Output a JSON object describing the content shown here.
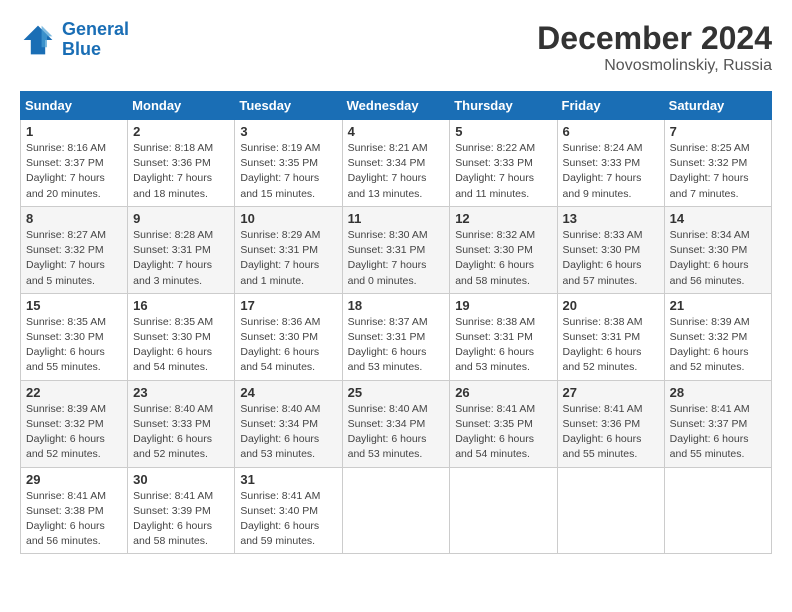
{
  "header": {
    "logo_line1": "General",
    "logo_line2": "Blue",
    "month_title": "December 2024",
    "location": "Novosmolinskiy, Russia"
  },
  "days_of_week": [
    "Sunday",
    "Monday",
    "Tuesday",
    "Wednesday",
    "Thursday",
    "Friday",
    "Saturday"
  ],
  "weeks": [
    [
      {
        "day": "1",
        "info": "Sunrise: 8:16 AM\nSunset: 3:37 PM\nDaylight: 7 hours\nand 20 minutes."
      },
      {
        "day": "2",
        "info": "Sunrise: 8:18 AM\nSunset: 3:36 PM\nDaylight: 7 hours\nand 18 minutes."
      },
      {
        "day": "3",
        "info": "Sunrise: 8:19 AM\nSunset: 3:35 PM\nDaylight: 7 hours\nand 15 minutes."
      },
      {
        "day": "4",
        "info": "Sunrise: 8:21 AM\nSunset: 3:34 PM\nDaylight: 7 hours\nand 13 minutes."
      },
      {
        "day": "5",
        "info": "Sunrise: 8:22 AM\nSunset: 3:33 PM\nDaylight: 7 hours\nand 11 minutes."
      },
      {
        "day": "6",
        "info": "Sunrise: 8:24 AM\nSunset: 3:33 PM\nDaylight: 7 hours\nand 9 minutes."
      },
      {
        "day": "7",
        "info": "Sunrise: 8:25 AM\nSunset: 3:32 PM\nDaylight: 7 hours\nand 7 minutes."
      }
    ],
    [
      {
        "day": "8",
        "info": "Sunrise: 8:27 AM\nSunset: 3:32 PM\nDaylight: 7 hours\nand 5 minutes."
      },
      {
        "day": "9",
        "info": "Sunrise: 8:28 AM\nSunset: 3:31 PM\nDaylight: 7 hours\nand 3 minutes."
      },
      {
        "day": "10",
        "info": "Sunrise: 8:29 AM\nSunset: 3:31 PM\nDaylight: 7 hours\nand 1 minute."
      },
      {
        "day": "11",
        "info": "Sunrise: 8:30 AM\nSunset: 3:31 PM\nDaylight: 7 hours\nand 0 minutes."
      },
      {
        "day": "12",
        "info": "Sunrise: 8:32 AM\nSunset: 3:30 PM\nDaylight: 6 hours\nand 58 minutes."
      },
      {
        "day": "13",
        "info": "Sunrise: 8:33 AM\nSunset: 3:30 PM\nDaylight: 6 hours\nand 57 minutes."
      },
      {
        "day": "14",
        "info": "Sunrise: 8:34 AM\nSunset: 3:30 PM\nDaylight: 6 hours\nand 56 minutes."
      }
    ],
    [
      {
        "day": "15",
        "info": "Sunrise: 8:35 AM\nSunset: 3:30 PM\nDaylight: 6 hours\nand 55 minutes."
      },
      {
        "day": "16",
        "info": "Sunrise: 8:35 AM\nSunset: 3:30 PM\nDaylight: 6 hours\nand 54 minutes."
      },
      {
        "day": "17",
        "info": "Sunrise: 8:36 AM\nSunset: 3:30 PM\nDaylight: 6 hours\nand 54 minutes."
      },
      {
        "day": "18",
        "info": "Sunrise: 8:37 AM\nSunset: 3:31 PM\nDaylight: 6 hours\nand 53 minutes."
      },
      {
        "day": "19",
        "info": "Sunrise: 8:38 AM\nSunset: 3:31 PM\nDaylight: 6 hours\nand 53 minutes."
      },
      {
        "day": "20",
        "info": "Sunrise: 8:38 AM\nSunset: 3:31 PM\nDaylight: 6 hours\nand 52 minutes."
      },
      {
        "day": "21",
        "info": "Sunrise: 8:39 AM\nSunset: 3:32 PM\nDaylight: 6 hours\nand 52 minutes."
      }
    ],
    [
      {
        "day": "22",
        "info": "Sunrise: 8:39 AM\nSunset: 3:32 PM\nDaylight: 6 hours\nand 52 minutes."
      },
      {
        "day": "23",
        "info": "Sunrise: 8:40 AM\nSunset: 3:33 PM\nDaylight: 6 hours\nand 52 minutes."
      },
      {
        "day": "24",
        "info": "Sunrise: 8:40 AM\nSunset: 3:34 PM\nDaylight: 6 hours\nand 53 minutes."
      },
      {
        "day": "25",
        "info": "Sunrise: 8:40 AM\nSunset: 3:34 PM\nDaylight: 6 hours\nand 53 minutes."
      },
      {
        "day": "26",
        "info": "Sunrise: 8:41 AM\nSunset: 3:35 PM\nDaylight: 6 hours\nand 54 minutes."
      },
      {
        "day": "27",
        "info": "Sunrise: 8:41 AM\nSunset: 3:36 PM\nDaylight: 6 hours\nand 55 minutes."
      },
      {
        "day": "28",
        "info": "Sunrise: 8:41 AM\nSunset: 3:37 PM\nDaylight: 6 hours\nand 55 minutes."
      }
    ],
    [
      {
        "day": "29",
        "info": "Sunrise: 8:41 AM\nSunset: 3:38 PM\nDaylight: 6 hours\nand 56 minutes."
      },
      {
        "day": "30",
        "info": "Sunrise: 8:41 AM\nSunset: 3:39 PM\nDaylight: 6 hours\nand 58 minutes."
      },
      {
        "day": "31",
        "info": "Sunrise: 8:41 AM\nSunset: 3:40 PM\nDaylight: 6 hours\nand 59 minutes."
      },
      null,
      null,
      null,
      null
    ]
  ]
}
